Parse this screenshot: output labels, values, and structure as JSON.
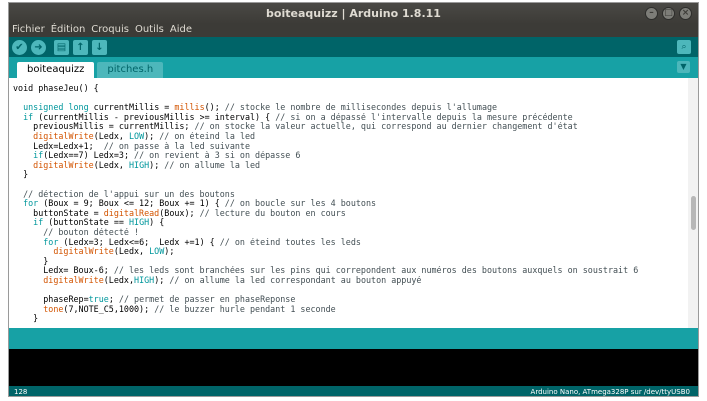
{
  "window": {
    "title": "boiteaquizz | Arduino 1.8.11"
  },
  "menu": [
    "Fichier",
    "Édition",
    "Croquis",
    "Outils",
    "Aide"
  ],
  "tabs": [
    {
      "label": "boiteaquizz",
      "active": true
    },
    {
      "label": "pitches.h",
      "active": false
    }
  ],
  "code_lines": [
    [
      [
        "",
        "void phaseJeu() {"
      ]
    ],
    [
      [
        "",
        ""
      ]
    ],
    [
      [
        "kw",
        "  unsigned long"
      ],
      [
        "",
        " currentMillis = "
      ],
      [
        "fn",
        "millis"
      ],
      [
        "",
        "(); "
      ],
      [
        "cm",
        "// stocke le nombre de millisecondes depuis l'allumage"
      ]
    ],
    [
      [
        "kw",
        "  if"
      ],
      [
        "",
        " (currentMillis - previousMillis >= interval) { "
      ],
      [
        "cm",
        "// si on a dépassé l'intervalle depuis la mesure précédente"
      ]
    ],
    [
      [
        "",
        "    previousMillis = currentMillis; "
      ],
      [
        "cm",
        "// on stocke la valeur actuelle, qui correspond au dernier changement d'état"
      ]
    ],
    [
      [
        "fn",
        "    digitalWrite"
      ],
      [
        "",
        "(Ledx, "
      ],
      [
        "kw",
        "LOW"
      ],
      [
        "",
        "); "
      ],
      [
        "cm",
        "// on éteind la led"
      ]
    ],
    [
      [
        "",
        "    Ledx=Ledx+1;  "
      ],
      [
        "cm",
        "// on passe à la led suivante"
      ]
    ],
    [
      [
        "kw",
        "    if"
      ],
      [
        "",
        "(Ledx==7) Ledx=3; "
      ],
      [
        "cm",
        "// on revient à 3 si on dépasse 6"
      ]
    ],
    [
      [
        "fn",
        "    digitalWrite"
      ],
      [
        "",
        "(Ledx, "
      ],
      [
        "kw",
        "HIGH"
      ],
      [
        "",
        "); "
      ],
      [
        "cm",
        "// on allume la led"
      ]
    ],
    [
      [
        "",
        "  }"
      ]
    ],
    [
      [
        "",
        ""
      ]
    ],
    [
      [
        "cm",
        "  // détection de l'appui sur un des boutons"
      ]
    ],
    [
      [
        "kw",
        "  for"
      ],
      [
        "",
        " (Boux = 9; Boux <= 12; Boux += 1) { "
      ],
      [
        "cm",
        "// on boucle sur les 4 boutons"
      ]
    ],
    [
      [
        "",
        "    buttonState = "
      ],
      [
        "fn",
        "digitalRead"
      ],
      [
        "",
        "(Boux); "
      ],
      [
        "cm",
        "// lecture du bouton en cours"
      ]
    ],
    [
      [
        "kw",
        "    if"
      ],
      [
        "",
        " (buttonState == "
      ],
      [
        "kw",
        "HIGH"
      ],
      [
        "",
        ") {"
      ]
    ],
    [
      [
        "cm",
        "      // bouton détecté !"
      ]
    ],
    [
      [
        "kw",
        "      for"
      ],
      [
        "",
        " (Ledx=3; Ledx<=6;  Ledx +=1) { "
      ],
      [
        "cm",
        "// on éteind toutes les leds"
      ]
    ],
    [
      [
        "fn",
        "        digitalWrite"
      ],
      [
        "",
        "(Ledx, "
      ],
      [
        "kw",
        "LOW"
      ],
      [
        "",
        ");"
      ]
    ],
    [
      [
        "",
        "      }"
      ]
    ],
    [
      [
        "",
        "      Ledx= Boux-6; "
      ],
      [
        "cm",
        "// les leds sont branchées sur les pins qui correpondent aux numéros des boutons auxquels on soustrait 6"
      ]
    ],
    [
      [
        "fn",
        "      digitalWrite"
      ],
      [
        "",
        "(Ledx,"
      ],
      [
        "kw",
        "HIGH"
      ],
      [
        "",
        "); "
      ],
      [
        "cm",
        "// on allume la led correspondant au bouton appuyé"
      ]
    ],
    [
      [
        "",
        ""
      ]
    ],
    [
      [
        "",
        "      phaseRep="
      ],
      [
        "kw",
        "true"
      ],
      [
        "",
        "; "
      ],
      [
        "cm",
        "// permet de passer en phaseReponse"
      ]
    ],
    [
      [
        "fn",
        "      tone"
      ],
      [
        "",
        "(7,NOTE_C5,1000); "
      ],
      [
        "cm",
        "// le buzzer hurle pendant 1 seconde"
      ]
    ],
    [
      [
        "",
        "    }"
      ]
    ]
  ],
  "status": {
    "line_number": "128",
    "board": "Arduino Nano, ATmega328P sur /dev/ttyUSB0"
  },
  "colors": {
    "toolbar": "#006468",
    "tabbar": "#17a1a5",
    "keyword": "#00979c",
    "function": "#d35400",
    "comment": "#434f54"
  },
  "icons": {
    "verify": "check-icon",
    "upload": "arrow-right-icon",
    "new": "new-file-icon",
    "open": "arrow-up-icon",
    "save": "arrow-down-icon",
    "serial": "magnifier-icon"
  }
}
